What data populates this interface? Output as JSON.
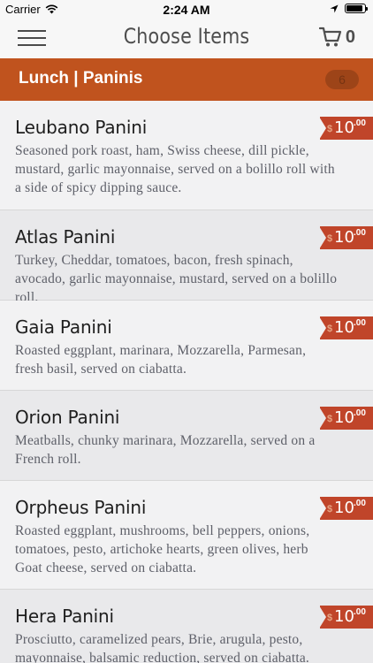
{
  "status_bar": {
    "carrier": "Carrier",
    "time": "2:24 AM"
  },
  "nav": {
    "title": "Choose Items",
    "cart_count": "0"
  },
  "category": {
    "title": "Lunch | Paninis",
    "count": "6"
  },
  "items": [
    {
      "name": "Leubano Panini",
      "description": "Seasoned pork roast, ham, Swiss cheese, dill pickle, mustard, garlic mayonnaise, served on a bolillo roll with a side of spicy dipping sauce.",
      "currency": "$",
      "price_whole": "10",
      "price_cents": ".00"
    },
    {
      "name": "Atlas Panini",
      "description": "Turkey, Cheddar, tomatoes, bacon, fresh spinach, avocado, garlic mayonnaise, mustard, served on a bolillo roll.",
      "currency": "$",
      "price_whole": "10",
      "price_cents": ".00"
    },
    {
      "name": "Gaia Panini",
      "description": "Roasted eggplant, marinara, Mozzarella, Parmesan, fresh basil, served on ciabatta.",
      "currency": "$",
      "price_whole": "10",
      "price_cents": ".00"
    },
    {
      "name": "Orion Panini",
      "description": "Meatballs, chunky marinara, Mozzarella, served on a French roll.",
      "currency": "$",
      "price_whole": "10",
      "price_cents": ".00"
    },
    {
      "name": "Orpheus Panini",
      "description": "Roasted eggplant, mushrooms, bell peppers, onions, tomatoes, pesto, artichoke hearts, green olives, herb Goat cheese, served on ciabatta.",
      "currency": "$",
      "price_whole": "10",
      "price_cents": ".00"
    },
    {
      "name": "Hera Panini",
      "description": "Prosciutto, caramelized pears, Brie, arugula, pesto, mayonnaise, balsamic reduction, served on ciabatta.",
      "currency": "$",
      "price_whole": "10",
      "price_cents": ".00"
    }
  ],
  "colors": {
    "category_bar": "#c0531e",
    "price_tag": "#c0452a"
  }
}
